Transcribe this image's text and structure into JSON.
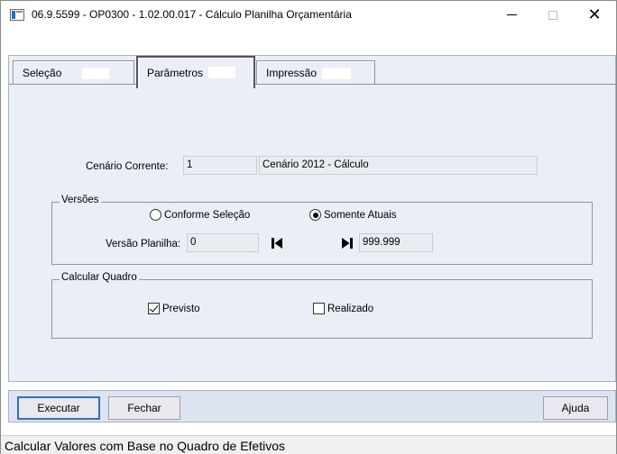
{
  "window": {
    "title": "06.9.5599 - OP0300 - 1.02.00.017 - Cálculo Planilha Orçamentária",
    "minimize_symbol": "—",
    "maximize_symbol": "☐",
    "close_symbol": "✕"
  },
  "tabs": [
    {
      "label": "Seleção",
      "selected": false
    },
    {
      "label": "Parâmetros",
      "selected": true
    },
    {
      "label": "Impressão",
      "selected": false
    }
  ],
  "form": {
    "cenario_label": "Cenário Corrente:",
    "cenario_code": "1",
    "cenario_desc": "Cenário 2012 - Cálculo",
    "versoes": {
      "legend": "Versões",
      "radio_conforme": {
        "label": "Conforme Seleção",
        "checked": false
      },
      "radio_somente": {
        "label": "Somente Atuais",
        "checked": true
      },
      "versao_label": "Versão Planilha:",
      "versao_from": "0",
      "versao_to": "999.999",
      "first_icon": "first-record-icon",
      "last_icon": "last-record-icon"
    },
    "calcular": {
      "legend": "Calcular Quadro",
      "previsto": {
        "label": "Previsto",
        "checked": true
      },
      "realizado": {
        "label": "Realizado",
        "checked": false
      }
    }
  },
  "buttons": {
    "executar": "Executar",
    "fechar": "Fechar",
    "ajuda": "Ajuda"
  },
  "status": {
    "text": "Calcular Valores com Base no Quadro de Efetivos"
  },
  "colors": {
    "panel_bg": "#eaeef7",
    "button_bar_bg": "#dce4f1",
    "default_button_border": "#2f6fc4",
    "app_icon_accent": "#1e6fc8"
  }
}
